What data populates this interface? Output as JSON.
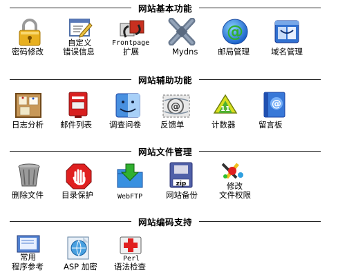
{
  "sections": [
    {
      "title": "网站基本功能"
    },
    {
      "title": "网站辅助功能"
    },
    {
      "title": "网站文件管理"
    },
    {
      "title": "网站编码支持"
    }
  ],
  "basic": {
    "password": {
      "label": "密码修改"
    },
    "error_page": {
      "label_line1": "自定义",
      "label_line2": "错误信息"
    },
    "frontpage": {
      "label_line1": "Frontpage",
      "label_line2": "扩展"
    },
    "mydns": {
      "label": "Mydns"
    },
    "mail": {
      "label": "邮局管理"
    },
    "domain": {
      "label": "域名管理"
    }
  },
  "aux": {
    "log": {
      "label": "日志分析"
    },
    "maillist": {
      "label": "邮件列表"
    },
    "survey": {
      "label": "调查问卷"
    },
    "feedback": {
      "label": "反馈单"
    },
    "counter": {
      "label": "计数器"
    },
    "guestbook": {
      "label": "留言板"
    }
  },
  "files": {
    "delete": {
      "label": "删除文件"
    },
    "protect": {
      "label": "目录保护"
    },
    "webftp": {
      "label": "WebFTP"
    },
    "backup": {
      "label": "网站备份"
    },
    "perm": {
      "label_line1": "修改",
      "label_line2": "文件权限"
    }
  },
  "coding": {
    "reference": {
      "label_line1": "常用",
      "label_line2": "程序参考"
    },
    "asp": {
      "label": "ASP 加密"
    },
    "perl": {
      "label_line1": "Perl",
      "label_line2": "语法检查"
    }
  }
}
